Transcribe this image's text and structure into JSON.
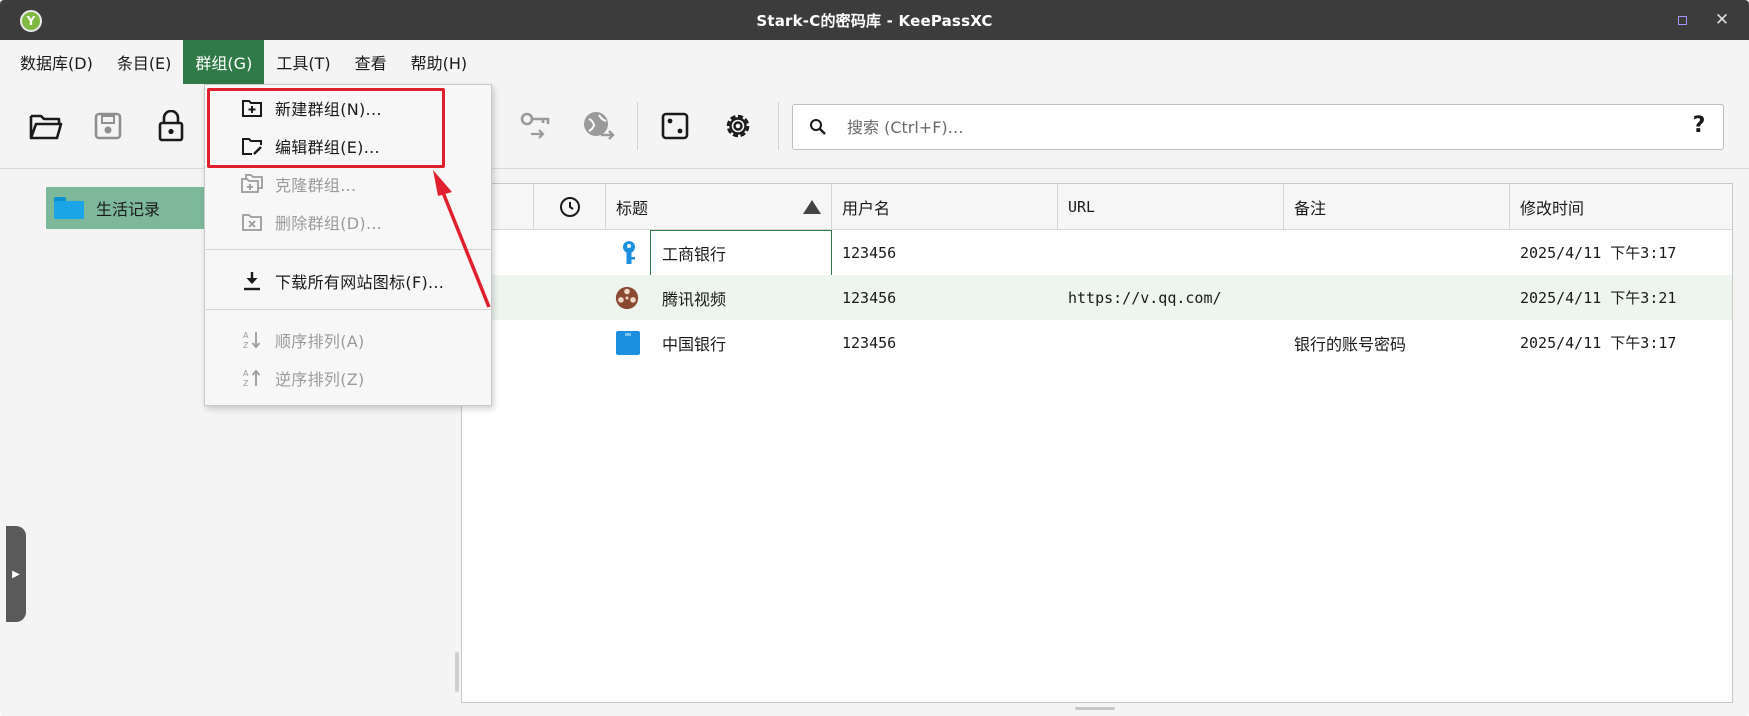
{
  "window": {
    "title": "Stark-C的密码库 - KeePassXC"
  },
  "menubar": {
    "items": [
      {
        "label": "数据库(D)"
      },
      {
        "label": "条目(E)"
      },
      {
        "label": "群组(G)",
        "active": true
      },
      {
        "label": "工具(T)"
      },
      {
        "label": "查看"
      },
      {
        "label": "帮助(H)"
      }
    ]
  },
  "toolbar": {
    "icons": [
      "open-database-icon",
      "save-database-icon",
      "lock-database-icon",
      "keys-icon",
      "globe-icon",
      "dice-icon",
      "settings-gear-icon"
    ],
    "search": {
      "placeholder": "搜索 (Ctrl+F)…",
      "help_label": "?"
    }
  },
  "group_tree": {
    "selected_group": "生活记录"
  },
  "group_menu": {
    "items": [
      {
        "label": "新建群组(N)...",
        "icon": "new-group-icon",
        "enabled": true
      },
      {
        "label": "编辑群组(E)...",
        "icon": "edit-group-icon",
        "enabled": true
      },
      {
        "label": "克隆群组...",
        "icon": "clone-group-icon",
        "enabled": false
      },
      {
        "label": "删除群组(D)…",
        "icon": "delete-group-icon",
        "enabled": false
      },
      {
        "label": "下载所有网站图标(F)...",
        "icon": "download-icon",
        "enabled": true
      },
      {
        "label": "顺序排列(A)",
        "icon": "sort-ascending-icon",
        "enabled": false
      },
      {
        "label": "逆序排列(Z)",
        "icon": "sort-descending-icon",
        "enabled": false
      }
    ]
  },
  "entries_table": {
    "columns": [
      "标题",
      "用户名",
      "URL",
      "备注",
      "修改时间"
    ],
    "rows": [
      {
        "title": "工商银行",
        "username": "123456",
        "url": "",
        "notes": "",
        "modified": "2025/4/11 下午3:17",
        "icon": "key-icon"
      },
      {
        "title": "腾讯视频",
        "username": "123456",
        "url": "https://v.qq.com/",
        "notes": "",
        "modified": "2025/4/11 下午3:21",
        "icon": "film-reel-icon"
      },
      {
        "title": "中国银行",
        "username": "123456",
        "url": "",
        "notes": "银行的账号密码",
        "modified": "2025/4/11 下午3:17",
        "icon": "blue-square-icon"
      }
    ]
  },
  "colors": {
    "accent_green": "#2f7a46",
    "selected_group_bg": "#7db89a",
    "alt_row_bg": "#eef5ef",
    "annotation_red": "#e0202e",
    "titlebar_bg": "#3c3c3c"
  }
}
